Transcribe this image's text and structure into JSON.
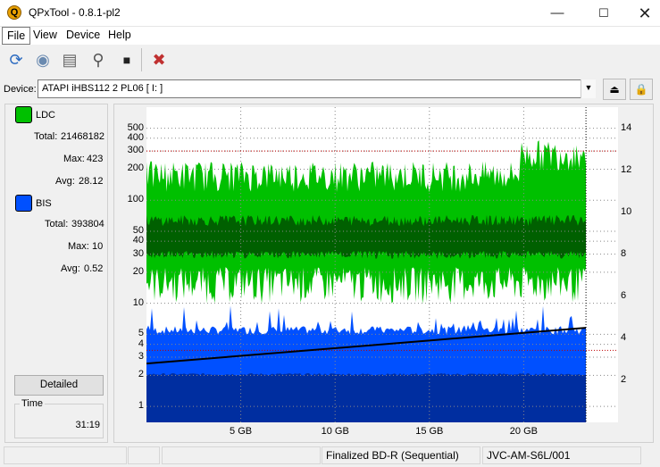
{
  "window": {
    "title": "QPxTool - 0.8.1-pl2",
    "app_icon_letter": "Q"
  },
  "menu": [
    "File",
    "View",
    "Device",
    "Help"
  ],
  "toolbar": {
    "icons": [
      "refresh-icon",
      "disc-info-icon",
      "drive-icon",
      "scan-icon",
      "stop-icon",
      "settings-tools-icon"
    ]
  },
  "device": {
    "label": "Device:",
    "selected": "ATAPI   iHBS112   2    PL06 [ I: ]"
  },
  "stats": {
    "ldc": {
      "name": "LDC",
      "color": "#00c000",
      "total_label": "Total:",
      "total": "21468182",
      "max_label": "Max:",
      "max": "423",
      "avg_label": "Avg:",
      "avg": "28.12"
    },
    "bis": {
      "name": "BIS",
      "color": "#0050ff",
      "total_label": "Total:",
      "total": "393804",
      "max_label": "Max:",
      "max": "10",
      "avg_label": "Avg:",
      "avg": "0.52"
    }
  },
  "detailed_button": "Detailed",
  "time": {
    "label": "Time",
    "value": "31:19"
  },
  "status": {
    "cell1": "",
    "cell2": "",
    "cell3": "",
    "disc": "Finalized BD-R (Sequential)",
    "media": "JVC-AM-S6L/001"
  },
  "chart_data": {
    "type": "area",
    "x_tick_labels": [
      "5 GB",
      "10 GB",
      "15 GB",
      "20 GB"
    ],
    "x_ticks_gb": [
      5,
      10,
      15,
      20
    ],
    "x_max_gb": 25,
    "data_end_gb": 23.3,
    "y_left_log": true,
    "y_left_range": [
      0.7,
      800
    ],
    "y_left_tick_labels": [
      "1",
      "2",
      "3",
      "4",
      "5",
      "10",
      "20",
      "30",
      "40",
      "50",
      "100",
      "200",
      "300",
      "400",
      "500"
    ],
    "y_right_range": [
      0,
      15
    ],
    "y_right_tick_labels": [
      "2",
      "4",
      "6",
      "8",
      "10",
      "12",
      "14"
    ],
    "grid": true,
    "series": [
      {
        "name": "LDC",
        "color": "#00c000",
        "avg_level": 45,
        "max_level": 200,
        "min_level": 18
      },
      {
        "name": "BIS",
        "color": "#0050ff",
        "level": 5
      },
      {
        "name": "Speed",
        "color": "#000000",
        "start": 2.8,
        "end": 4.5
      }
    ],
    "colors": {
      "ldc_dark": "#006000",
      "bis_dark": "#002ea0",
      "grid": "#888888",
      "red_guide": "#c00000"
    }
  }
}
